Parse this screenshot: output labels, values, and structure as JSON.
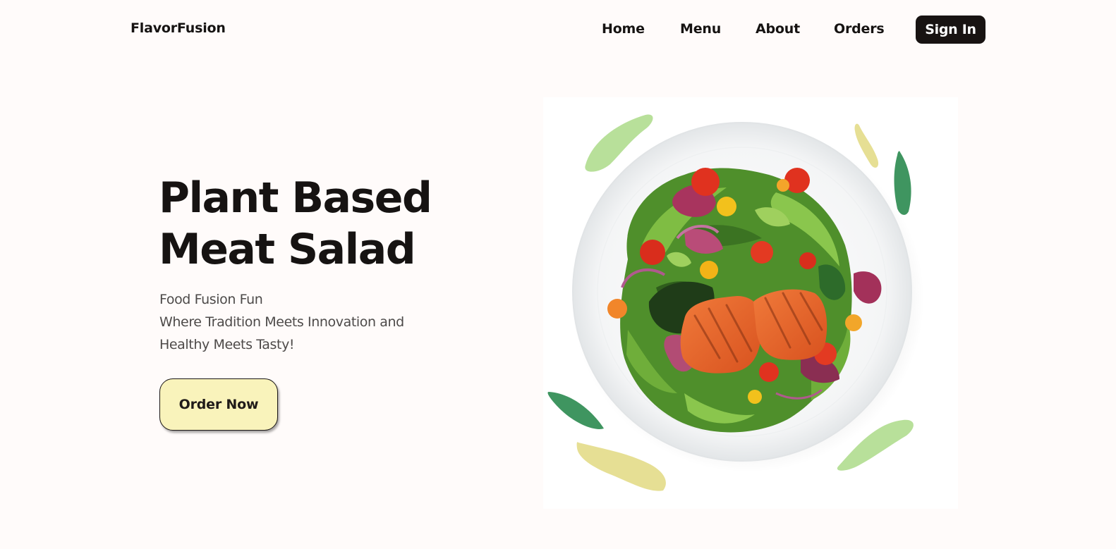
{
  "header": {
    "logo": "FlavorFusion",
    "nav": [
      {
        "label": "Home"
      },
      {
        "label": "Menu"
      },
      {
        "label": "About"
      },
      {
        "label": "Orders"
      }
    ],
    "sign_in_label": "Sign In"
  },
  "hero": {
    "title_lines": [
      "Plant Based",
      "Meat Salad"
    ],
    "subtitle_lines": [
      "Food Fusion Fun",
      "Where Tradition Meets Innovation and",
      "Healthy Meets Tasty!"
    ],
    "cta_label": "Order Now",
    "image": {
      "description_icon": "salad-plate-icon",
      "leaf_colors": [
        "#b8e09a",
        "#e6df94",
        "#3f9560"
      ]
    }
  },
  "colors": {
    "background": "#fffbfa",
    "text": "#161312",
    "button_dark": "#181312",
    "cta_bg": "#f9f3bb"
  }
}
